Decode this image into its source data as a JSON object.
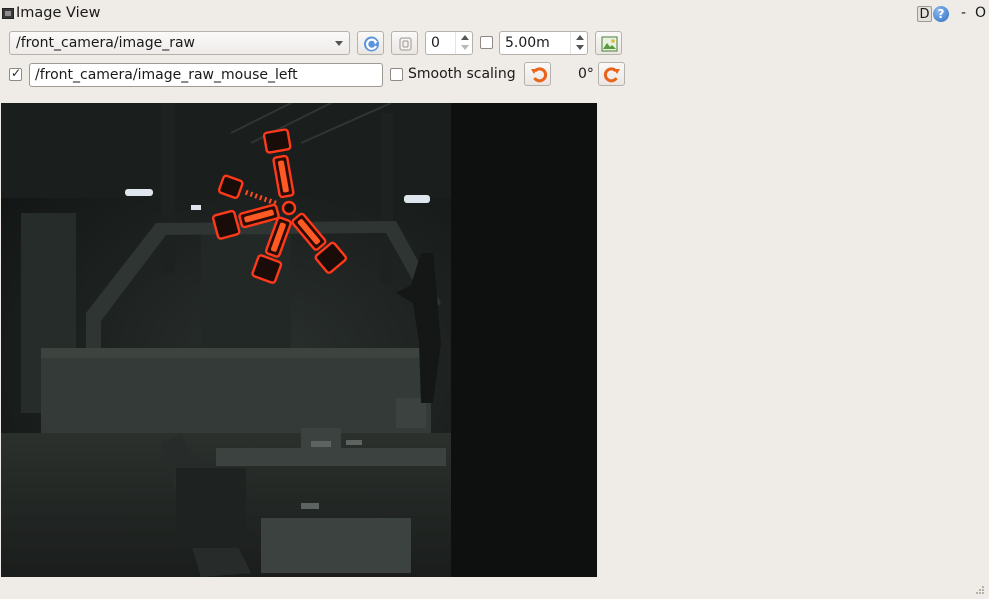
{
  "window": {
    "title": "Image View",
    "d_label": "D",
    "help_label": "?",
    "min_label": "-",
    "close_label": "O"
  },
  "toolbar": {
    "topic_selected": "/front_camera/image_raw",
    "number_value": "0",
    "duration_value": "5.00m",
    "mouse_topic_checked": true,
    "mouse_topic_value": "/front_camera/image_raw_mouse_left",
    "smooth_scaling_label": "Smooth scaling",
    "smooth_scaling_checked": false,
    "rotation_label": "0°"
  },
  "icons": {
    "refresh": "refresh-icon",
    "zoom_fit": "zoom-fit-icon",
    "save": "save-image-icon",
    "rotate_left": "rotate-left-icon",
    "rotate_right": "rotate-right-icon"
  },
  "colors": {
    "accent_orange": "#e8641c",
    "refresh_blue": "#3d7fcf",
    "marker_red": "#ff3a1a"
  }
}
